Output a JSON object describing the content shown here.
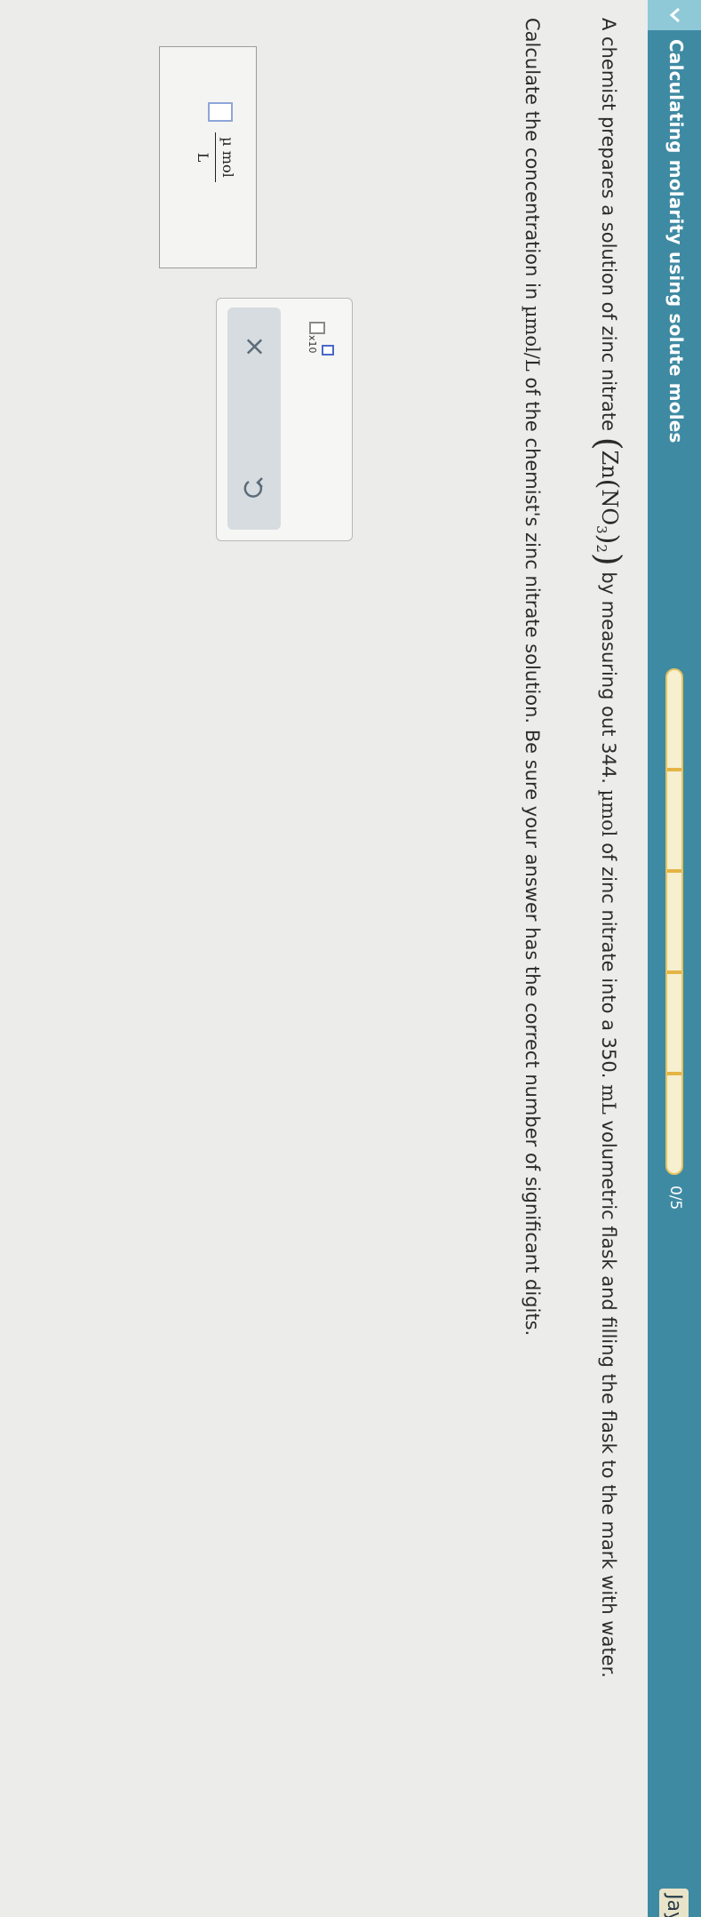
{
  "header": {
    "title": "Calculating molarity using solute moles",
    "progress_count": "0/5",
    "progress_fraction": 0,
    "user_name": "Jay"
  },
  "problem": {
    "p1_before": "A chemist prepares a solution of zinc nitrate ",
    "formula_zn": "Zn",
    "formula_no": "NO",
    "formula_sub3": "3",
    "formula_sub2": "2",
    "p1_mid": " by measuring out 344. ",
    "unit_umol": "µmol",
    "p1_after_umol": " of zinc nitrate into a 350. ",
    "unit_ml": "mL",
    "p1_end": " volumetric flask and filling the flask to the mark with water.",
    "p2_before": "Calculate the concentration in ",
    "unit_umol_per_l": "µmol/L",
    "p2_after": " of the chemist's zinc nitrate solution. Be sure your answer has the correct number of significant digits."
  },
  "answer": {
    "numerator_unit": "µ mol",
    "denominator_unit": "L"
  },
  "tools": {
    "x10_label": "x10",
    "clear_symbol": "×"
  },
  "colors": {
    "header_bg": "#3f8aa3",
    "progress_fill": "#e5b445",
    "input_border": "#8ea6d8"
  }
}
